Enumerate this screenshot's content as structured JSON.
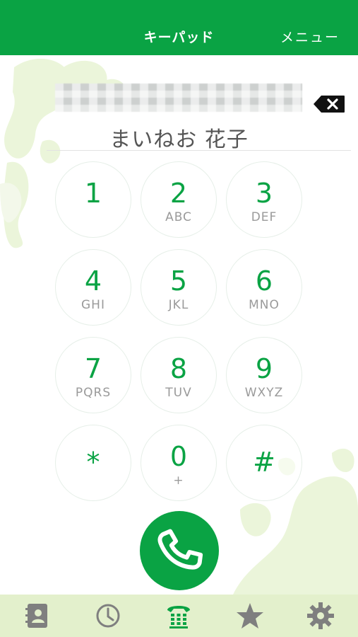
{
  "header": {
    "title": "キーパッド",
    "menu_label": "メニュー",
    "bg_color": "#0aa344"
  },
  "dialer": {
    "number_display": "",
    "contact_name": "まいねお 花子",
    "backspace_icon": "backspace-icon"
  },
  "keypad": [
    {
      "digit": "1",
      "letters": ""
    },
    {
      "digit": "2",
      "letters": "ABC"
    },
    {
      "digit": "3",
      "letters": "DEF"
    },
    {
      "digit": "4",
      "letters": "GHI"
    },
    {
      "digit": "5",
      "letters": "JKL"
    },
    {
      "digit": "6",
      "letters": "MNO"
    },
    {
      "digit": "7",
      "letters": "PQRS"
    },
    {
      "digit": "8",
      "letters": "TUV"
    },
    {
      "digit": "9",
      "letters": "WXYZ"
    },
    {
      "digit": "*",
      "letters": ""
    },
    {
      "digit": "0",
      "letters": "+"
    },
    {
      "digit": "#",
      "letters": ""
    }
  ],
  "call_button": {
    "icon": "phone-handset-icon",
    "color": "#0aa344"
  },
  "tabbar": {
    "items": [
      {
        "icon": "contacts-book-icon"
      },
      {
        "icon": "clock-icon"
      },
      {
        "icon": "keypad-phone-icon",
        "active": true
      },
      {
        "icon": "star-icon"
      },
      {
        "icon": "gear-icon"
      }
    ],
    "bg_color": "#e3f0cc",
    "active_color": "#0aa344",
    "inactive_color": "#7f7f7f"
  }
}
